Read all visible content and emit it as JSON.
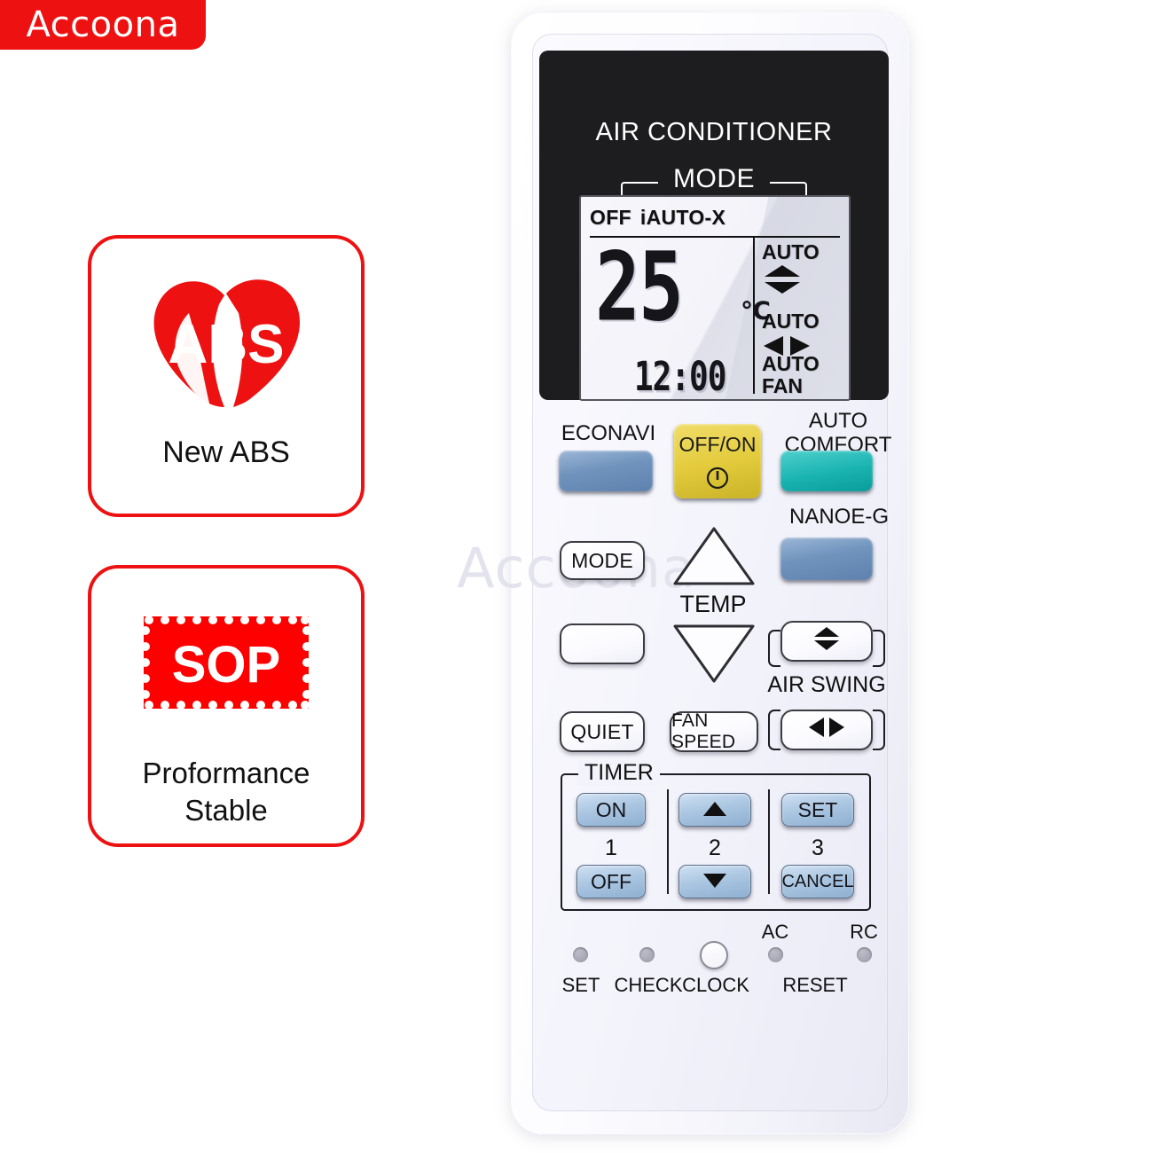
{
  "brand": {
    "name": "Accoona",
    "color": "#ee1111"
  },
  "features": [
    {
      "id": "abs",
      "logo_text": "ABS",
      "logo_icon": "heart-leaf-icon",
      "caption": "New ABS"
    },
    {
      "id": "sop",
      "logo_text": "SOP",
      "logo_icon": "postage-stamp-icon",
      "caption_line1": "Proformance",
      "caption_line2": "Stable"
    }
  ],
  "remote": {
    "watermark": "Accoona",
    "panel": {
      "title": "AIR CONDITIONER",
      "mode_label": "MODE"
    },
    "lcd": {
      "status_off": "OFF",
      "status_mode": "iAUTO-X",
      "temperature": "25",
      "unit": "℃",
      "clock": "12:00",
      "swing_vertical_label": "AUTO",
      "swing_vertical_icon": "up-down-arrows-icon",
      "swing_horizontal_label": "AUTO",
      "swing_horizontal_icon": "left-right-arrows-icon",
      "fan_label_line1": "AUTO",
      "fan_label_line2": "FAN"
    },
    "buttons": {
      "econavi": "ECONAVI",
      "off_on": "OFF/ON",
      "off_on_icon": "power-icon",
      "auto_comfort_line1": "AUTO",
      "auto_comfort_line2": "COMFORT",
      "nanoe_g": "NANOE-G",
      "mode": "MODE",
      "blank": "",
      "temp": "TEMP",
      "temp_up_icon": "triangle-up-icon",
      "temp_down_icon": "triangle-down-icon",
      "quiet": "QUIET",
      "fan_speed": "FAN SPEED",
      "air_swing": "AIR SWING",
      "air_swing_vertical_icon": "up-down-arrows-icon",
      "air_swing_horizontal_icon": "left-right-arrows-icon"
    },
    "timer": {
      "legend": "TIMER",
      "on": "ON",
      "off": "OFF",
      "up_icon": "triangle-up-icon",
      "down_icon": "triangle-down-icon",
      "set": "SET",
      "cancel": "CANCEL",
      "step1": "1",
      "step2": "2",
      "step3": "3"
    },
    "bottom": {
      "set": "SET",
      "check": "CHECK",
      "clock": "CLOCK",
      "reset": "RESET",
      "ac": "AC",
      "rc": "RC"
    }
  },
  "colors": {
    "brand_red": "#ee1111",
    "panel_black": "#1d1d1f",
    "button_blue": "#6f93bd",
    "button_teal": "#19b3b0",
    "button_yellow": "#e4cc3e",
    "timer_blue": "#a8c4e0"
  }
}
